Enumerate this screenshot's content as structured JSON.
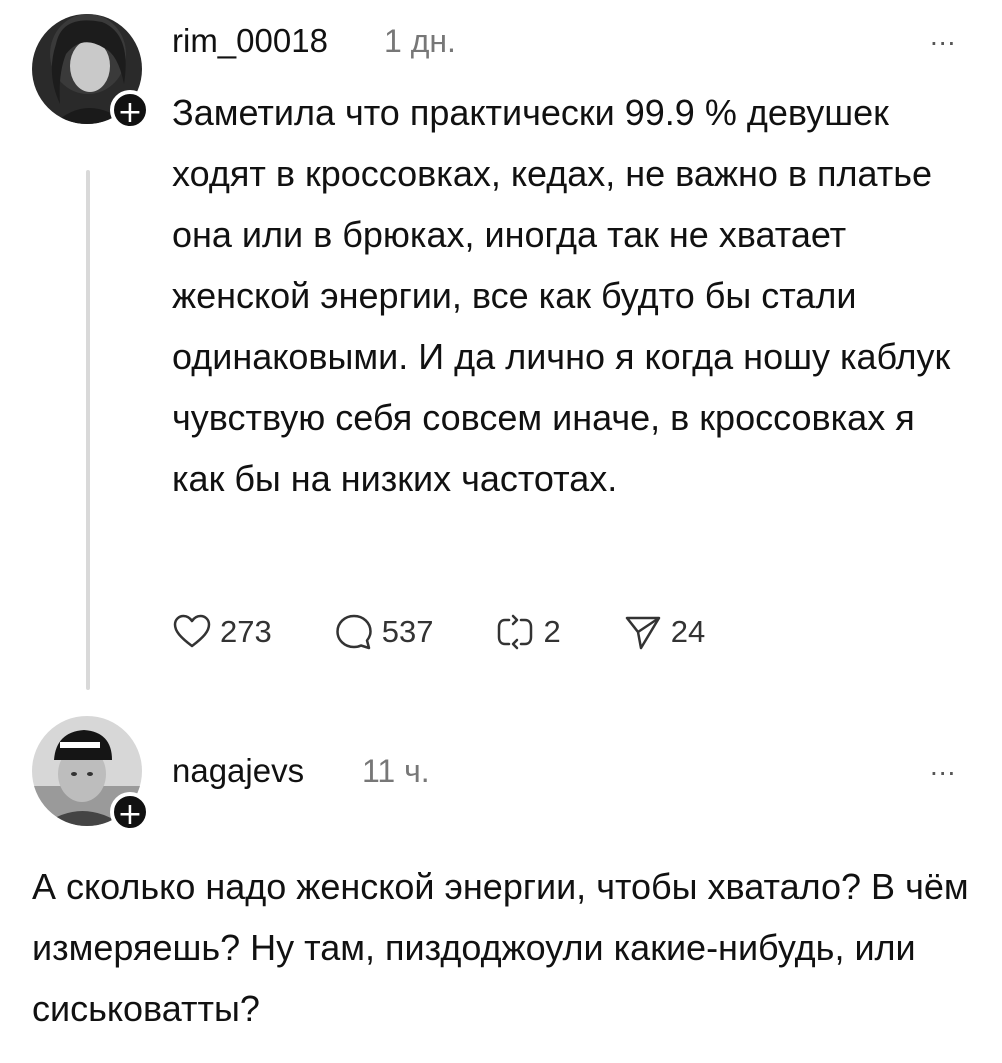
{
  "posts": [
    {
      "username": "rim_00018",
      "time": "1 дн.",
      "more": "...",
      "text": "Заметила что практически 99.9 % девушек ходят в кроссовках, кедах, не важно в платье она или в брюках, иногда так не хватает женской энергии, все как будто бы стали одинаковыми. И да лично я когда ношу каблук чувствую себя совсем иначе, в кроссовках я как бы на низких частотах.",
      "actions": {
        "likes": "273",
        "comments": "537",
        "reposts": "2",
        "shares": "24"
      }
    },
    {
      "username": "nagajevs",
      "time": "11 ч.",
      "more": "...",
      "text": "А сколько надо женской энергии, чтобы хватало? В чём измеряешь? Ну там, пиздоджоули какие-нибудь, или сиськоватты?"
    }
  ],
  "icons": {
    "like": "heart-icon",
    "comment": "comment-bubble-icon",
    "repost": "repost-icon",
    "share": "send-icon",
    "follow": "plus-icon",
    "more": "more-dots-icon"
  }
}
